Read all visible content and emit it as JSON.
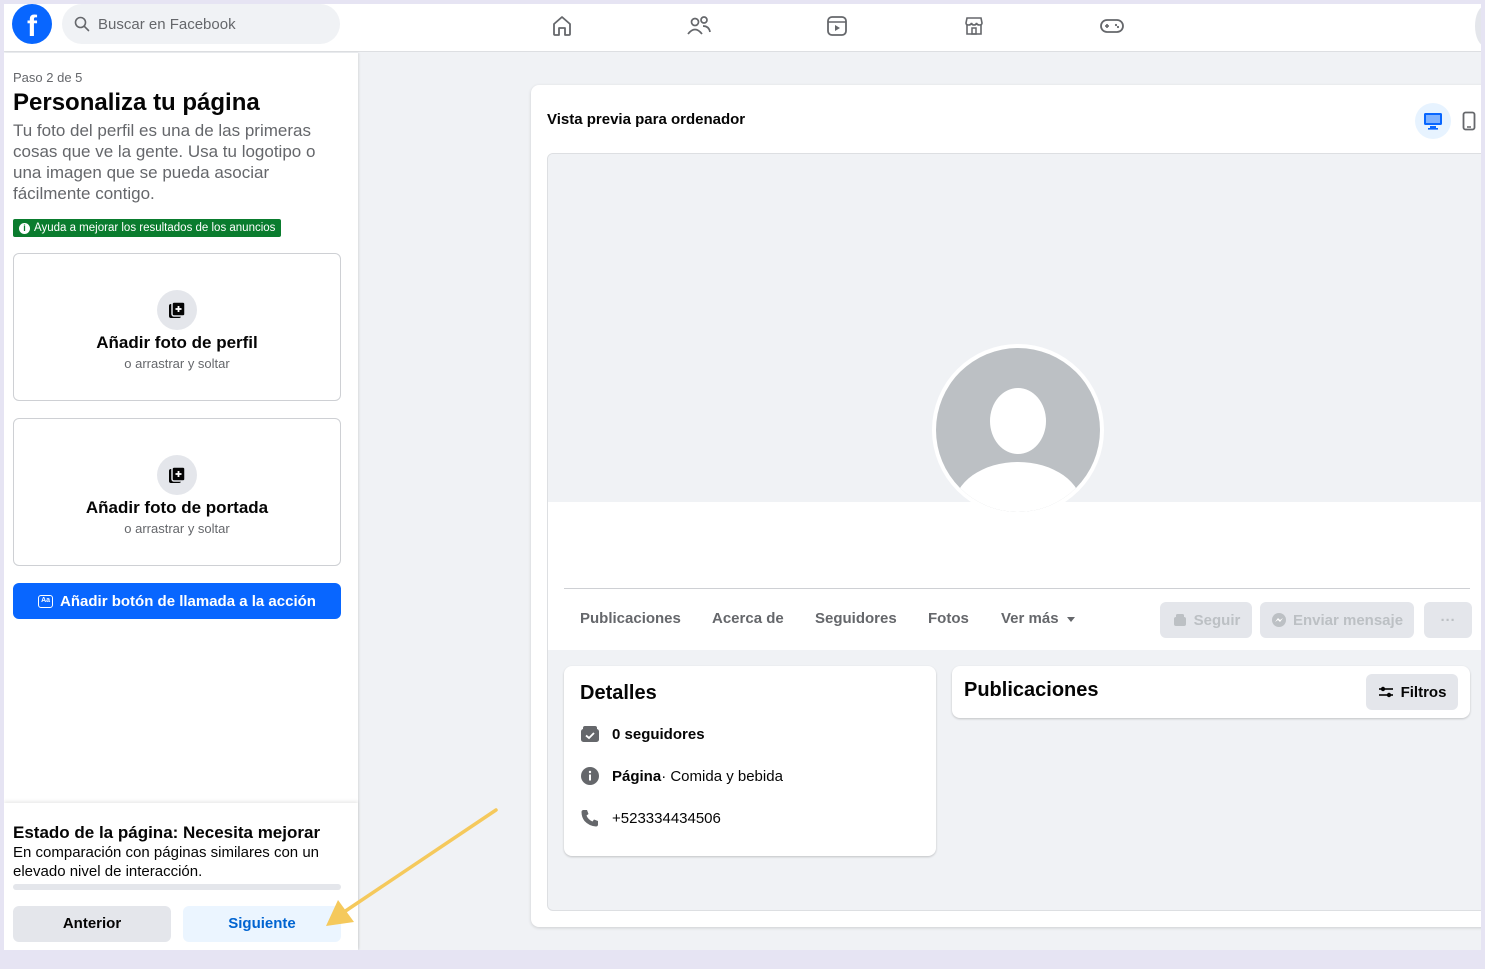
{
  "search": {
    "placeholder": "Buscar en Facebook"
  },
  "nav": [
    "home-icon",
    "friends-icon",
    "video-icon",
    "marketplace-icon",
    "gaming-icon"
  ],
  "left": {
    "step": "Paso 2 de 5",
    "title": "Personaliza tu página",
    "description": "Tu foto del perfil es una de las primeras cosas que ve la gente. Usa tu logotipo o una imagen que se pueda asociar fácilmente contigo.",
    "badge": "Ayuda a mejorar los resultados de los anuncios",
    "profile_photo": {
      "label": "Añadir foto de perfil",
      "sub": "o arrastrar y soltar"
    },
    "cover_photo": {
      "label": "Añadir foto de portada",
      "sub": "o arrastrar y soltar"
    },
    "cta_button": "Añadir botón de llamada a la acción",
    "status": {
      "title": "Estado de la página: Necesita mejorar",
      "description": "En comparación con páginas similares con un elevado nivel de interacción."
    },
    "prev_button": "Anterior",
    "next_button": "Siguiente"
  },
  "preview": {
    "title": "Vista previa para ordenador",
    "tabs": [
      "Publicaciones",
      "Acerca de",
      "Seguidores",
      "Fotos",
      "Ver más"
    ],
    "follow_button": "Seguir",
    "message_button": "Enviar mensaje",
    "more_button": "···",
    "details": {
      "title": "Detalles",
      "followers": "0 seguidores",
      "page_label": "Página",
      "page_category": " · Comida y bebida",
      "phone": "+523334434506"
    },
    "posts": {
      "title": "Publicaciones",
      "filter_button": "Filtros"
    }
  },
  "colors": {
    "brand": "#0866ff",
    "badge": "#0a7c2e",
    "arrow": "#f5c95c"
  }
}
